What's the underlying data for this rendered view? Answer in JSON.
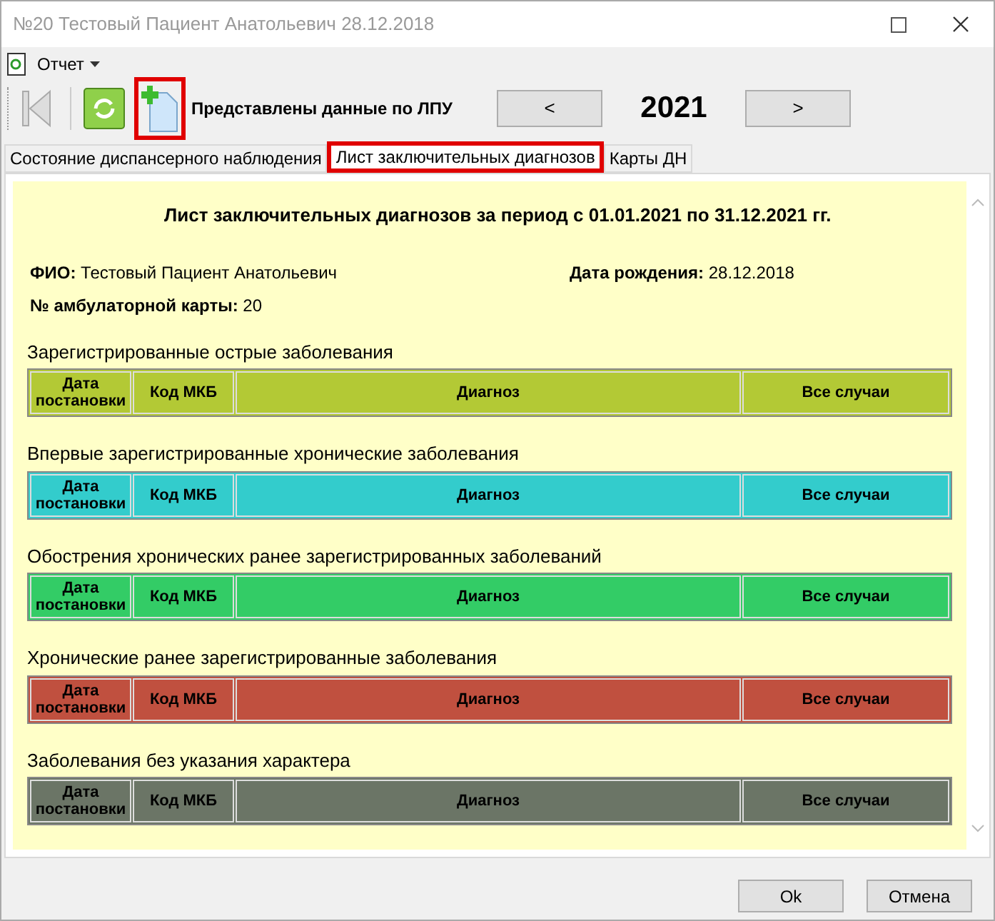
{
  "window": {
    "title": "№20 Тестовый Пациент Анатольевич 28.12.2018"
  },
  "menu": [
    {
      "label": "Отчет"
    }
  ],
  "toolbar": {
    "add_highlighted": true,
    "status": "Представлены данные по ЛПУ",
    "prev": "<",
    "year": "2021",
    "next": ">"
  },
  "tabs": [
    {
      "label": "Состояние диспансерного наблюдения",
      "selected": false,
      "highlighted": false
    },
    {
      "label": "Лист заключительных диагнозов",
      "selected": true,
      "highlighted": true
    },
    {
      "label": "Карты ДН",
      "selected": false,
      "highlighted": false
    }
  ],
  "report": {
    "title": "Лист заключительных диагнозов за период с 01.01.2021 по 31.12.2021 гг.",
    "fields": [
      {
        "label": "ФИО:",
        "value": "Тестовый Пациент Анатольевич"
      },
      {
        "label": "Дата рождения:",
        "value": "28.12.2018"
      },
      {
        "label": "№ амбулаторной карты:",
        "value": "20"
      }
    ],
    "sections": [
      {
        "title": "Зарегистрированные острые заболевания",
        "color": "#b3c935",
        "columns": [
          "Дата постановки",
          "Код МКБ",
          "Диагноз",
          "Все случаи"
        ]
      },
      {
        "title": "Впервые зарегистрированные хронические заболевания",
        "color": "#33cccc",
        "columns": [
          "Дата постановки",
          "Код МКБ",
          "Диагноз",
          "Все случаи"
        ]
      },
      {
        "title": "Обострения хронических ранее зарегистрированных заболеваний",
        "color": "#33cc66",
        "columns": [
          "Дата постановки",
          "Код МКБ",
          "Диагноз",
          "Все случаи"
        ]
      },
      {
        "title": "Хронические ранее зарегистрированные заболевания",
        "color": "#c0503f",
        "columns": [
          "Дата постановки",
          "Код МКБ",
          "Диагноз",
          "Все случаи"
        ]
      },
      {
        "title": "Заболевания без указания характера",
        "color": "#6b7566",
        "columns": [
          "Дата постановки",
          "Код МКБ",
          "Диагноз",
          "Все случаи"
        ]
      }
    ]
  },
  "buttons": [
    "Ok",
    "Отмена"
  ]
}
